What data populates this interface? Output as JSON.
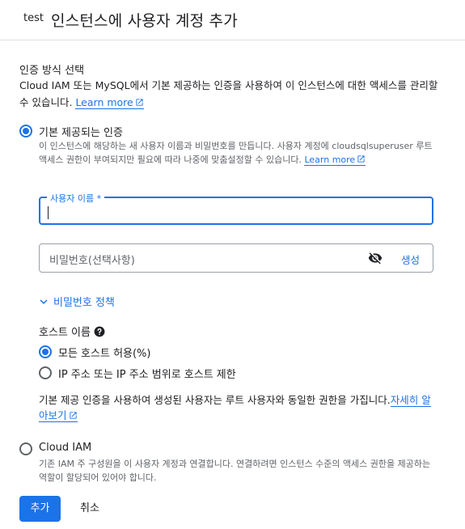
{
  "header": {
    "instance": "test",
    "title": "인스턴스에 사용자 계정 추가"
  },
  "auth": {
    "title": "인증 방식 선택",
    "description": "Cloud IAM 또는 MySQL에서 기본 제공하는 인증을 사용하여 이 인스턴스에 대한 액세스를 관리할 수 있습니다.",
    "learn_more": "Learn more"
  },
  "builtin": {
    "label": "기본 제공되는 인증",
    "selected": true,
    "description": "이 인스턴스에 해당하는 새 사용자 이름과 비밀번호를 만듭니다. 사용자 계정에 cloudsqlsuperuser 루트 액세스 권한이 부여되지만 필요에 따라 나중에 맞춤설정할 수 있습니다.",
    "learn_more": "Learn more",
    "username_label": "사용자 이름 *",
    "username_value": "",
    "password_placeholder": "비밀번호(선택사항)",
    "generate_label": "생성",
    "policy_label": "비밀번호 정책",
    "host_title": "호스트 이름",
    "host_options": [
      {
        "label": "모든 호스트 허용(%)",
        "selected": true
      },
      {
        "label": "IP 주소 또는 IP 주소 범위로 호스트 제한",
        "selected": false
      }
    ],
    "note": "기본 제공 인증을 사용하여 생성된 사용자는 루트 사용자와 동일한 권한을 가집니다.",
    "note_link": "자세히 알아보기"
  },
  "iam": {
    "label": "Cloud IAM",
    "selected": false,
    "description": "기존 IAM 주 구성원을 이 사용자 계정과 연결합니다. 연결하려면 인스턴스 수준의 액세스 권한을 제공하는 역할이 할당되어 있어야 합니다."
  },
  "actions": {
    "add_label": "추가",
    "cancel_label": "취소"
  },
  "colors": {
    "accent": "#1a73e8",
    "text": "#202124",
    "muted": "#5f6368"
  },
  "icons": {
    "external_link": "external-link-icon",
    "visibility_off": "visibility-off-icon",
    "chevron_down": "chevron-down-icon",
    "help": "help-icon"
  }
}
